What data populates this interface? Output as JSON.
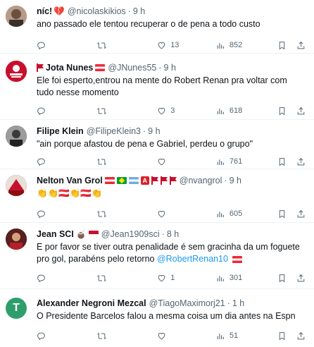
{
  "tweets": [
    {
      "name": "níc!",
      "handle": "@nicolaskikios",
      "time": "9 h",
      "text": "ano passado ele tentou recuperar o de pena a todo custo",
      "likes": "13",
      "views": "852",
      "replies": "",
      "retweets": "",
      "avatar_color": "#8a6f63"
    },
    {
      "name": "Jota Nunes",
      "handle": "@JNunes55",
      "time": "9 h",
      "text": "Ele foi esperto,entrou na mente do Robert Renan pra voltar com tudo nesse momento",
      "likes": "3",
      "views": "618",
      "replies": "",
      "retweets": "",
      "avatar_color": "#c8102e",
      "avatar_text": "CORNETADA"
    },
    {
      "name": "Filipe Klein",
      "handle": "@FilipeKlein3",
      "time": "9 h",
      "text": "\"ain porque afastou de pena e Gabriel, perdeu o grupo\"",
      "likes": "",
      "views": "761",
      "replies": "",
      "retweets": "",
      "avatar_color": "#5b5b5b"
    },
    {
      "name": "Nelton Van Grol",
      "handle": "@nvangrol",
      "time": "9 h",
      "text": "👏👏🇦🇹👏🇦🇹👏",
      "likes": "",
      "views": "605",
      "replies": "",
      "retweets": "",
      "avatar_color": "#c8102e"
    },
    {
      "name": "Jean SCI",
      "handle": "@Jean1909sci",
      "time": "8 h",
      "text": "E por favor se tiver outra penalidade é sem gracinha da um foguete pro gol, parabéns pelo retorno",
      "mention": "@RobertRenan10",
      "likes": "1",
      "views": "301",
      "replies": "",
      "retweets": "",
      "avatar_color": "#7a2b2b"
    },
    {
      "name": "Alexander Negroni Mezcal",
      "handle": "@TiagoMaximorj21",
      "time": "1 h",
      "text": "O Presidente Barcelos falou a mesma coisa um dia antes na Espn",
      "likes": "",
      "views": "51",
      "replies": "",
      "retweets": "",
      "avatar_color": "#2e9e6b",
      "avatar_letter": "T"
    }
  ],
  "colors": {
    "text": "#0f1419",
    "secondary": "#536471",
    "link": "#1d9bf0",
    "border": "#eff3f4"
  },
  "icons": [
    "reply-icon",
    "retweet-icon",
    "like-icon",
    "views-icon",
    "bookmark-icon",
    "share-icon"
  ]
}
